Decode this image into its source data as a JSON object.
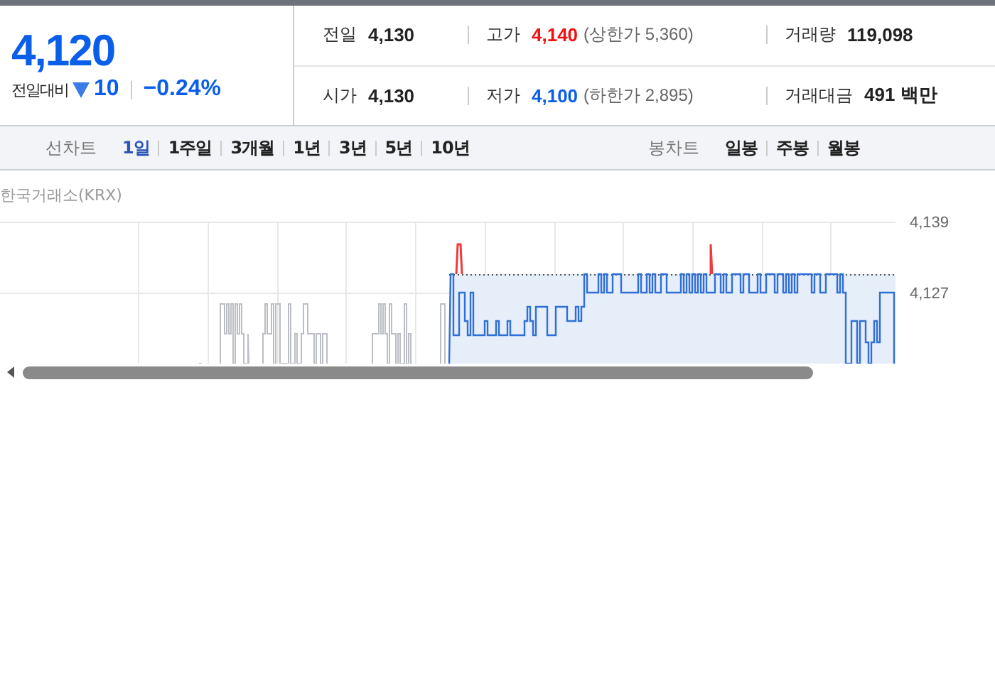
{
  "quote": {
    "price": "4,120",
    "change_label": "전일대비",
    "falling": true,
    "change": "10",
    "change_rate": "−0.24%"
  },
  "stats": [
    [
      {
        "label": "전일",
        "value": "4,130",
        "color": "#222222"
      },
      {
        "label": "고가",
        "value": "4,140",
        "color": "#f21010",
        "note": "(상한가 5,360)"
      },
      {
        "label": "거래량",
        "value": "119,098",
        "color": "#222222"
      }
    ],
    [
      {
        "label": "시가",
        "value": "4,130",
        "color": "#222222"
      },
      {
        "label": "저가",
        "value": "4,100",
        "color": "#0a5ee8",
        "note": "(하한가 2,895)"
      },
      {
        "label": "거래대금",
        "value": "491 백만",
        "color": "#222222"
      }
    ]
  ],
  "toolbar": [
    {
      "label": "선차트",
      "options": [
        {
          "label": "1일",
          "selected": true
        },
        {
          "label": "1주일",
          "selected": false
        },
        {
          "label": "3개월",
          "selected": false
        },
        {
          "label": "1년",
          "selected": false
        },
        {
          "label": "3년",
          "selected": false
        },
        {
          "label": "5년",
          "selected": false
        },
        {
          "label": "10년",
          "selected": false
        }
      ]
    },
    {
      "label": "봉차트",
      "options": [
        {
          "label": "일봉",
          "selected": false
        },
        {
          "label": "주봉",
          "selected": false
        },
        {
          "label": "월봉",
          "selected": false
        }
      ]
    }
  ],
  "chart": {
    "source": "한국거래소(KRX)",
    "y_ticks": [
      "4,139",
      "4,127"
    ]
  }
}
